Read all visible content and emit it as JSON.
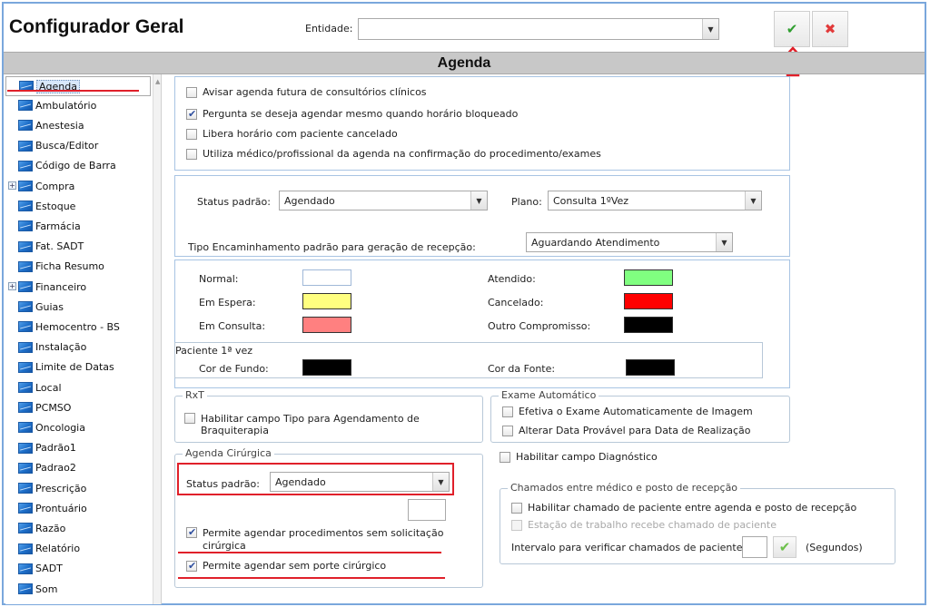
{
  "app": {
    "title": "Configurador Geral",
    "entity_label": "Entidade:",
    "entity_value": "",
    "confirm_icon": "✔",
    "cancel_icon": "✖",
    "section_title": "Agenda"
  },
  "sidebar": {
    "items": [
      {
        "label": "Agenda",
        "expandable": false,
        "selected": true
      },
      {
        "label": "Ambulatório",
        "expandable": false
      },
      {
        "label": "Anestesia",
        "expandable": false
      },
      {
        "label": "Busca/Editor",
        "expandable": false
      },
      {
        "label": "Código de Barra",
        "expandable": false
      },
      {
        "label": "Compra",
        "expandable": true
      },
      {
        "label": "Estoque",
        "expandable": false
      },
      {
        "label": "Farmácia",
        "expandable": false
      },
      {
        "label": "Fat. SADT",
        "expandable": false
      },
      {
        "label": "Ficha Resumo",
        "expandable": false
      },
      {
        "label": "Financeiro",
        "expandable": true
      },
      {
        "label": "Guias",
        "expandable": false
      },
      {
        "label": "Hemocentro - BS",
        "expandable": false
      },
      {
        "label": "Instalação",
        "expandable": false
      },
      {
        "label": "Limite de Datas",
        "expandable": false
      },
      {
        "label": "Local",
        "expandable": false
      },
      {
        "label": "PCMSO",
        "expandable": false
      },
      {
        "label": "Oncologia",
        "expandable": false
      },
      {
        "label": "Padrão1",
        "expandable": false
      },
      {
        "label": "Padrao2",
        "expandable": false
      },
      {
        "label": "Prescrição",
        "expandable": false
      },
      {
        "label": "Prontuário",
        "expandable": false
      },
      {
        "label": "Razão",
        "expandable": false
      },
      {
        "label": "Relatório",
        "expandable": false
      },
      {
        "label": "SADT",
        "expandable": false
      },
      {
        "label": "Som",
        "expandable": false
      }
    ]
  },
  "top_options": [
    {
      "label": "Avisar agenda futura de consultórios clínicos",
      "checked": false
    },
    {
      "label": "Pergunta se deseja agendar mesmo quando horário bloqueado",
      "checked": true
    },
    {
      "label": "Libera horário com paciente cancelado",
      "checked": false
    },
    {
      "label": "Utiliza médico/profissional da agenda na confirmação do procedimento/exames",
      "checked": false
    }
  ],
  "status": {
    "status_label": "Status padrão:",
    "status_value": "Agendado",
    "plano_label": "Plano:",
    "plano_value": "Consulta 1ºVez",
    "encaminhamento_label": "Tipo Encaminhamento padrão para geração de recepção:",
    "encaminhamento_value": "Aguardando Atendimento"
  },
  "colors": {
    "normal": {
      "label": "Normal:",
      "color": "#ffffff"
    },
    "em_espera": {
      "label": "Em Espera:",
      "color": "#ffff80"
    },
    "em_consulta": {
      "label": "Em Consulta:",
      "color": "#ff8080"
    },
    "atendido": {
      "label": "Atendido:",
      "color": "#80ff80"
    },
    "cancelado": {
      "label": "Cancelado:",
      "color": "#ff0000"
    },
    "outro": {
      "label": "Outro Compromisso:",
      "color": "#000000"
    },
    "primeira_vez_title": "Paciente 1ª vez",
    "cor_fundo": {
      "label": "Cor de Fundo:",
      "color": "#000000"
    },
    "cor_fonte": {
      "label": "Cor da Fonte:",
      "color": "#000000"
    }
  },
  "rxt": {
    "legend": "RxT",
    "option_line1": "Habilitar campo Tipo para Agendamento de",
    "option_line2": "Braquiterapia",
    "checked": false
  },
  "exame": {
    "legend": "Exame Automático",
    "options": [
      {
        "label": "Efetiva o Exame Automaticamente de Imagem",
        "checked": false
      },
      {
        "label": "Alterar Data Provável para Data de Realização",
        "checked": false
      }
    ]
  },
  "diagnostico": {
    "label": "Habilitar campo Diagnóstico",
    "checked": false
  },
  "cirurgica": {
    "legend": "Agenda Cirúrgica",
    "status_label": "Status padrão:",
    "status_value": "Agendado",
    "opt1_line1": "Permite agendar procedimentos sem solicitação",
    "opt1_line2": "cirúrgica",
    "opt1_checked": true,
    "opt2": "Permite agendar sem porte cirúrgico",
    "opt2_checked": true
  },
  "chamados": {
    "legend": "Chamados entre médico e posto de recepção",
    "opt1": "Habilitar chamado de paciente entre agenda e posto de recepção",
    "opt1_checked": false,
    "opt2": "Estação de trabalho recebe chamado de paciente",
    "opt2_checked": false,
    "intervalo_label": "Intervalo para verificar chamados de paciente:",
    "intervalo_value": "",
    "segundos_label": "(Segundos)"
  }
}
